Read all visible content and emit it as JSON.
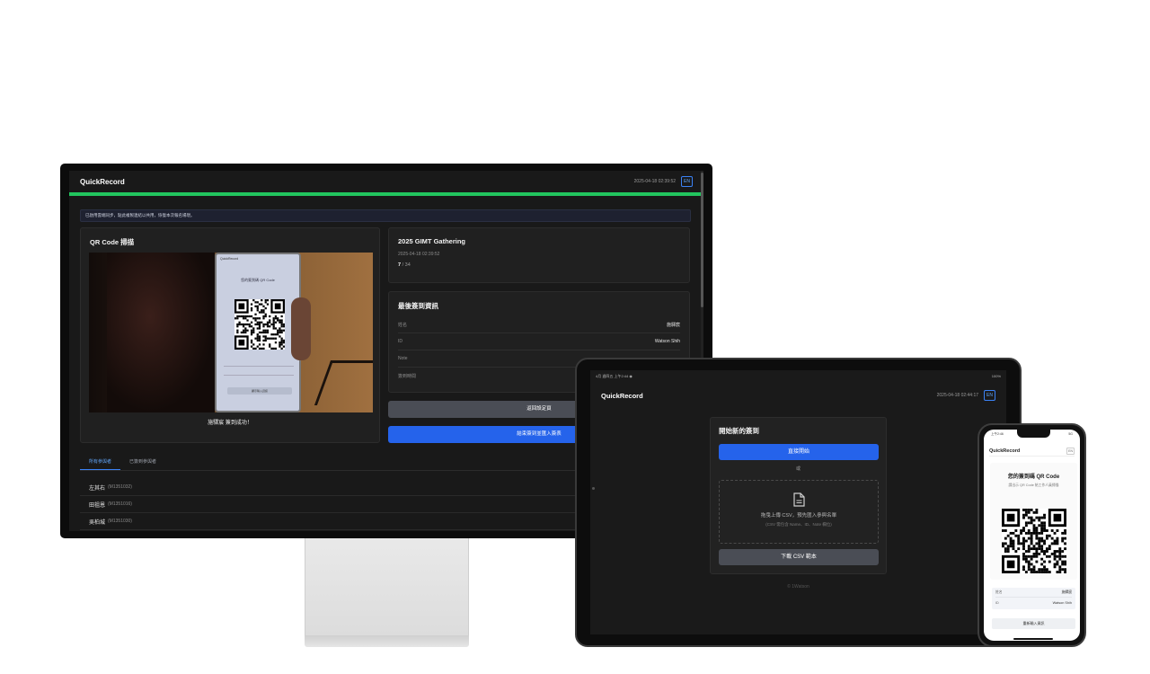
{
  "brand": "QuickRecord",
  "monitor": {
    "timestamp": "2025-04-18 02:39:52",
    "lang": "EN",
    "notice": "已啟用雲端同步，點此複製連結以共用，恢復本次報名場現。",
    "qr_title": "QR Code 掃描",
    "scan_message": "施驛宸 簽到成功！",
    "video_phone": {
      "brand": "QuickRecord",
      "title": "您的簽到碼 QR Code",
      "button": "顯示輸入資訊"
    },
    "event_name": "2025 GIMT Gathering",
    "event_time": "2025-04-18 02:39:52",
    "checked_in": "7",
    "total": "/ 34",
    "last_title": "最後簽到資訊",
    "fields": [
      {
        "label": "姓名",
        "value": "施驛宸"
      },
      {
        "label": "ID",
        "value": "Watson Shih"
      },
      {
        "label": "Note",
        "value": ""
      },
      {
        "label": "簽到時間",
        "value": ""
      }
    ],
    "back_button": "返回設定頁",
    "end_button": "結束簽到並匯入簽表",
    "tabs": [
      "所有參與者",
      "已簽到參與者"
    ],
    "participants": [
      {
        "name": "左其右",
        "id": "(M1351032)"
      },
      {
        "name": "田祖恩",
        "id": "(M1351016)"
      },
      {
        "name": "吳柏城",
        "id": "(M1351030)"
      }
    ]
  },
  "tablet": {
    "status_left": "4月 週四五 上午2:44 ◉",
    "status_right": "100%",
    "timestamp": "2025-04-18 02:44:17",
    "lang": "EN",
    "card_title": "開始新的簽到",
    "start_button": "直接開始",
    "or": "或",
    "drop_main": "拖曳上傳 CSV，預先匯入參與名單",
    "drop_sub": "(CSV 需包含 Name、ID、Note 欄位)",
    "csv_button": "下載 CSV 範本",
    "footer": "© 1Watson"
  },
  "phone": {
    "time": "上午2:46",
    "signal": "5G",
    "lang": "EN",
    "title": "您的簽到碼 QR Code",
    "subtitle": "請出示 QR Code 給工作人員掃描",
    "fields": [
      {
        "label": "姓名",
        "value": "施驛宸"
      },
      {
        "label": "ID",
        "value": "Watson Shih"
      }
    ],
    "button": "重新輸入資訊"
  },
  "colors": {
    "accent_blue": "#2563eb",
    "progress_green": "#22c55e",
    "dark_bg": "#191919"
  },
  "icons": [
    "file-icon",
    "qr-code-icon"
  ]
}
